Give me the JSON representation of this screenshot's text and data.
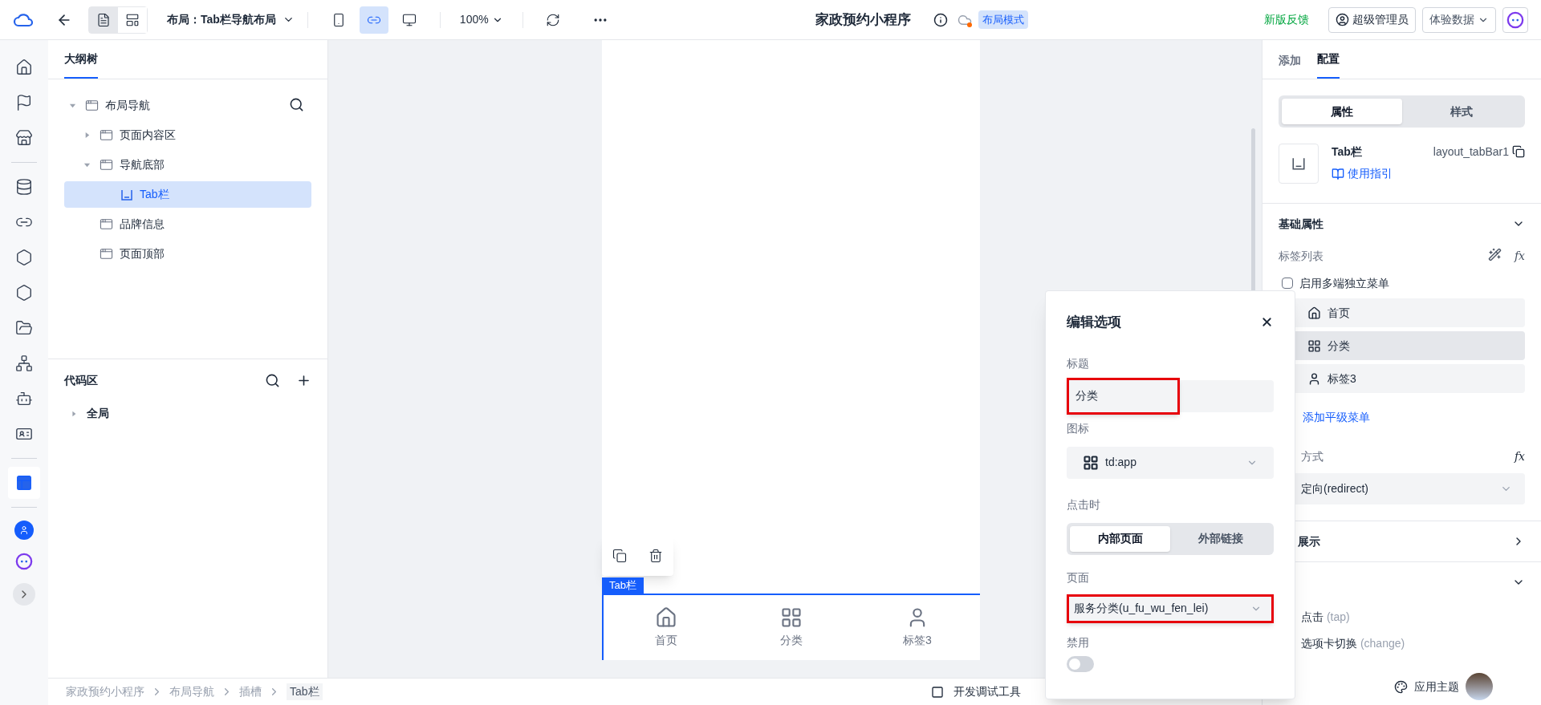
{
  "top_bar": {
    "view_modes": [
      {
        "selected": true
      },
      {
        "selected": false
      }
    ],
    "layout_label": "布局：Tab栏导航布局",
    "devices": [
      {
        "kind": "phone",
        "selected": false
      },
      {
        "kind": "miniprogram",
        "selected": true
      },
      {
        "kind": "desktop",
        "selected": false
      }
    ],
    "zoom": "100%",
    "app_title": "家政预约小程序",
    "mode_badge": "布局模式",
    "feedback_link": "新版反馈",
    "user": "超级管理员",
    "data_env": "体验数据"
  },
  "rail_items": [
    {
      "kind": "home",
      "selected": false
    },
    {
      "kind": "flag",
      "selected": false
    },
    {
      "kind": "shop",
      "selected": false
    },
    {
      "kind": "sep"
    },
    {
      "kind": "database",
      "selected": false
    },
    {
      "kind": "link",
      "selected": false
    },
    {
      "kind": "api",
      "selected": false
    },
    {
      "kind": "hexagon",
      "selected": false
    },
    {
      "kind": "folder",
      "selected": false
    },
    {
      "kind": "flow",
      "selected": false
    },
    {
      "kind": "bot",
      "selected": false
    },
    {
      "kind": "card",
      "selected": false
    },
    {
      "kind": "sep"
    },
    {
      "kind": "layout",
      "selected": true
    },
    {
      "kind": "sep"
    },
    {
      "kind": "avatar",
      "selected": false
    },
    {
      "kind": "ai",
      "selected": false
    },
    {
      "kind": "expand",
      "selected": false
    }
  ],
  "outline": {
    "tab": "大纲树",
    "tree": [
      {
        "label": "布局导航",
        "kind": "block",
        "expanded": true,
        "selected": false,
        "children": [
          {
            "label": "页面内容区",
            "kind": "block",
            "expanded": false,
            "selected": false
          },
          {
            "label": "导航底部",
            "kind": "block",
            "expanded": true,
            "selected": false,
            "children": [
              {
                "label": "Tab栏",
                "kind": "tabbar",
                "selected": true
              }
            ]
          },
          {
            "label": "品牌信息",
            "kind": "block",
            "selected": false
          },
          {
            "label": "页面顶部",
            "kind": "block",
            "selected": false
          }
        ]
      }
    ]
  },
  "code_area": {
    "title": "代码区",
    "tree": [
      {
        "label": "全局",
        "expanded": false
      }
    ]
  },
  "breadcrumb": [
    "家政预约小程序",
    "布局导航",
    "插槽",
    "Tab栏"
  ],
  "dev_tools": "开发调试工具",
  "canvas": {
    "selection_label": "Tab栏",
    "tabs": [
      {
        "label": "首页",
        "kind": "home"
      },
      {
        "label": "分类",
        "kind": "app"
      },
      {
        "label": "标签3",
        "kind": "user"
      }
    ]
  },
  "right_panel": {
    "tabs": [
      {
        "label": "添加",
        "selected": false
      },
      {
        "label": "配置",
        "selected": true
      }
    ],
    "segments": [
      {
        "label": "属性",
        "selected": true
      },
      {
        "label": "样式",
        "selected": false
      }
    ],
    "component": {
      "name": "Tab栏",
      "guide_link": "使用指引",
      "id": "layout_tabBar1"
    },
    "basic_section": {
      "title": "基础属性",
      "expanded": true
    },
    "tab_list_label": "标签列表",
    "tab_list_formula": "fx",
    "multi_menu": {
      "label": "启用多端独立菜单",
      "checked": false
    },
    "tab_items": [
      {
        "label": "首页",
        "kind": "home",
        "selected": false
      },
      {
        "label": "分类",
        "kind": "app",
        "selected": true
      },
      {
        "label": "标签3",
        "kind": "user",
        "selected": false
      }
    ],
    "add_menu": "添加平级菜单",
    "jump_label": "方式",
    "jump_formula": "fx",
    "jump_value": "定向(redirect)",
    "display_section": {
      "title": "展示",
      "expanded": false
    },
    "events_section": {
      "expanded": true
    },
    "events": [
      {
        "label": "点击",
        "code": "(tap)"
      },
      {
        "label": "选项卡切换",
        "code": "(change)"
      }
    ],
    "theme_button": "应用主题"
  },
  "edit_popup": {
    "title": "编辑选项",
    "title_label": "标题",
    "title_value": "分类",
    "icon_label": "图标",
    "icon_value": "td:app",
    "click_label": "点击时",
    "click_options": [
      {
        "label": "内部页面",
        "selected": true
      },
      {
        "label": "外部链接",
        "selected": false
      }
    ],
    "page_label": "页面",
    "page_value": "服务分类(u_fu_wu_fen_lei)",
    "disabled_label": "禁用",
    "disabled_on": false
  }
}
